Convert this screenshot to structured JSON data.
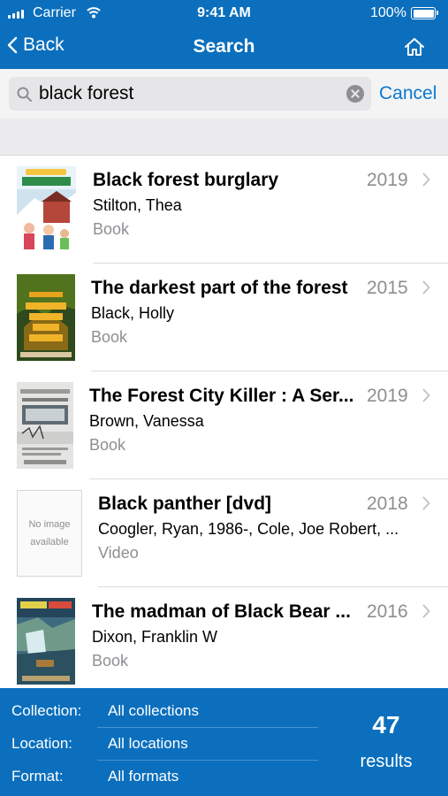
{
  "status_bar": {
    "carrier": "Carrier",
    "time": "9:41 AM",
    "battery": "100%"
  },
  "nav": {
    "back_label": "Back",
    "title": "Search"
  },
  "search": {
    "value": "black forest",
    "cancel_label": "Cancel"
  },
  "results": [
    {
      "title": "Black forest burglary",
      "year": "2019",
      "author": "Stilton, Thea",
      "type": "Book"
    },
    {
      "title": "The darkest part of the forest",
      "year": "2015",
      "author": "Black, Holly",
      "type": "Book"
    },
    {
      "title": "The Forest City Killer : A Ser...",
      "year": "2019",
      "author": "Brown, Vanessa",
      "type": "Book"
    },
    {
      "title": "Black panther [dvd]",
      "year": "2018",
      "author": "Coogler, Ryan, 1986-, Cole, Joe Robert, ...",
      "type": "Video",
      "no_image_line1": "No image",
      "no_image_line2": "available"
    },
    {
      "title": "The madman of Black Bear ...",
      "year": "2016",
      "author": "Dixon, Franklin W",
      "type": "Book"
    }
  ],
  "filters": {
    "collection_label": "Collection:",
    "collection_value": "All collections",
    "location_label": "Location:",
    "location_value": "All locations",
    "format_label": "Format:",
    "format_value": "All formats"
  },
  "result_count": "47",
  "result_count_label": "results",
  "colors": {
    "brand_blue": "#0b6fbd",
    "link_blue": "#0b77d1",
    "secondary_text": "#8e8e93"
  }
}
